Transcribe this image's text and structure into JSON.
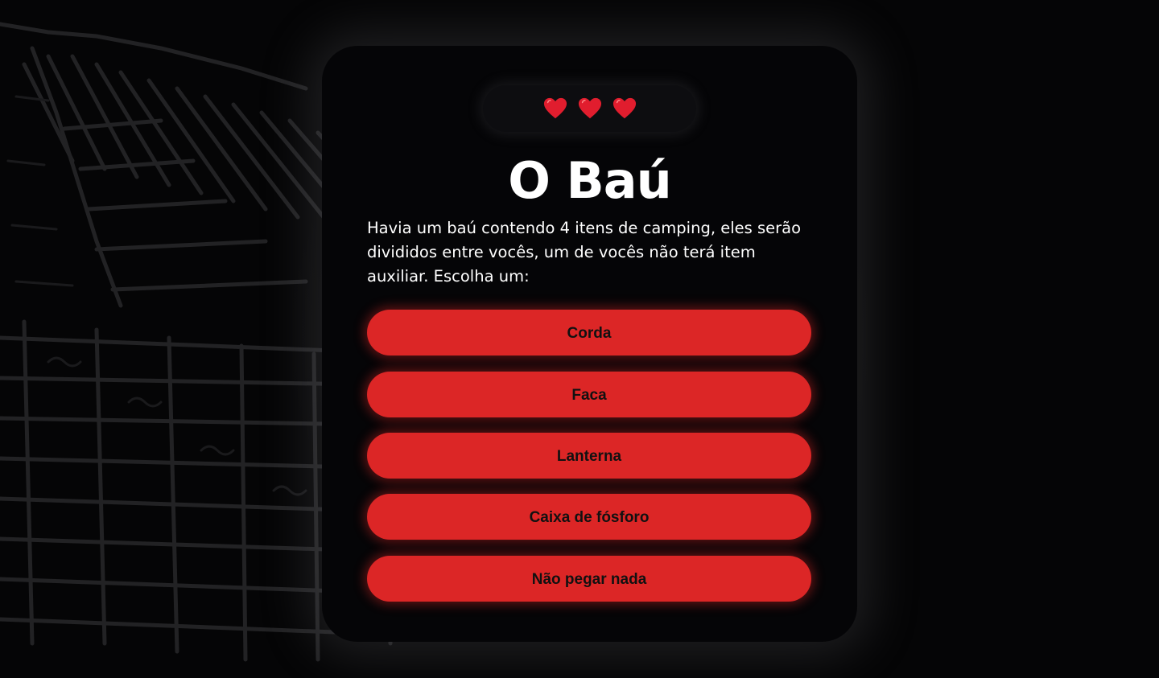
{
  "game": {
    "lives": [
      "heart-icon",
      "heart-icon",
      "heart-icon"
    ],
    "heart_color": "#e11d2e",
    "title": "O Baú",
    "description": "Havia um baú contendo 4 itens de camping, eles serão divididos entre vocês, um de vocês não terá item auxiliar. Escolha um:",
    "options": [
      {
        "label": "Corda"
      },
      {
        "label": "Faca"
      },
      {
        "label": "Lanterna"
      },
      {
        "label": "Caixa de fósforo"
      },
      {
        "label": "Não pegar nada"
      }
    ]
  },
  "theme": {
    "background": "#050506",
    "card": "#050507",
    "accent": "#dc2626",
    "text": "#ffffff"
  }
}
